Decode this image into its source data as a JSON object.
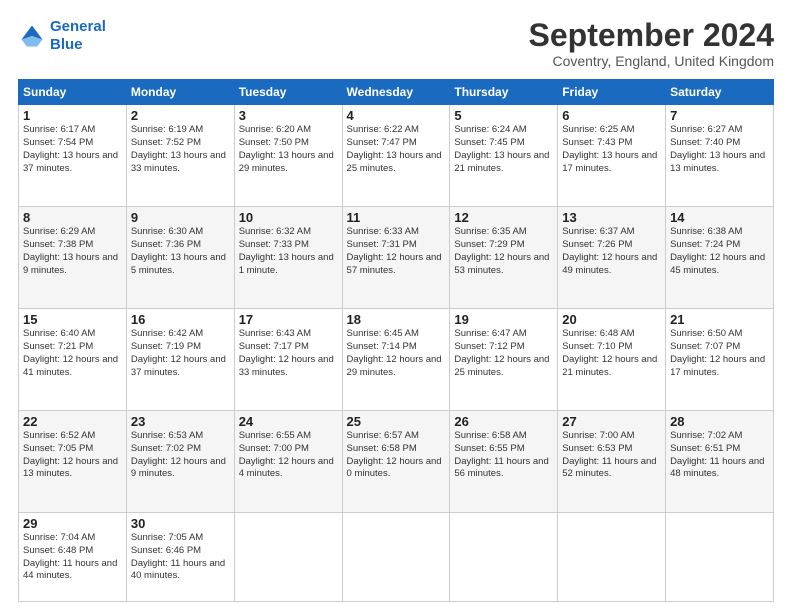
{
  "header": {
    "logo_line1": "General",
    "logo_line2": "Blue",
    "month_title": "September 2024",
    "location": "Coventry, England, United Kingdom"
  },
  "days_of_week": [
    "Sunday",
    "Monday",
    "Tuesday",
    "Wednesday",
    "Thursday",
    "Friday",
    "Saturday"
  ],
  "weeks": [
    [
      {
        "day": "1",
        "sunrise": "Sunrise: 6:17 AM",
        "sunset": "Sunset: 7:54 PM",
        "daylight": "Daylight: 13 hours and 37 minutes."
      },
      {
        "day": "2",
        "sunrise": "Sunrise: 6:19 AM",
        "sunset": "Sunset: 7:52 PM",
        "daylight": "Daylight: 13 hours and 33 minutes."
      },
      {
        "day": "3",
        "sunrise": "Sunrise: 6:20 AM",
        "sunset": "Sunset: 7:50 PM",
        "daylight": "Daylight: 13 hours and 29 minutes."
      },
      {
        "day": "4",
        "sunrise": "Sunrise: 6:22 AM",
        "sunset": "Sunset: 7:47 PM",
        "daylight": "Daylight: 13 hours and 25 minutes."
      },
      {
        "day": "5",
        "sunrise": "Sunrise: 6:24 AM",
        "sunset": "Sunset: 7:45 PM",
        "daylight": "Daylight: 13 hours and 21 minutes."
      },
      {
        "day": "6",
        "sunrise": "Sunrise: 6:25 AM",
        "sunset": "Sunset: 7:43 PM",
        "daylight": "Daylight: 13 hours and 17 minutes."
      },
      {
        "day": "7",
        "sunrise": "Sunrise: 6:27 AM",
        "sunset": "Sunset: 7:40 PM",
        "daylight": "Daylight: 13 hours and 13 minutes."
      }
    ],
    [
      {
        "day": "8",
        "sunrise": "Sunrise: 6:29 AM",
        "sunset": "Sunset: 7:38 PM",
        "daylight": "Daylight: 13 hours and 9 minutes."
      },
      {
        "day": "9",
        "sunrise": "Sunrise: 6:30 AM",
        "sunset": "Sunset: 7:36 PM",
        "daylight": "Daylight: 13 hours and 5 minutes."
      },
      {
        "day": "10",
        "sunrise": "Sunrise: 6:32 AM",
        "sunset": "Sunset: 7:33 PM",
        "daylight": "Daylight: 13 hours and 1 minute."
      },
      {
        "day": "11",
        "sunrise": "Sunrise: 6:33 AM",
        "sunset": "Sunset: 7:31 PM",
        "daylight": "Daylight: 12 hours and 57 minutes."
      },
      {
        "day": "12",
        "sunrise": "Sunrise: 6:35 AM",
        "sunset": "Sunset: 7:29 PM",
        "daylight": "Daylight: 12 hours and 53 minutes."
      },
      {
        "day": "13",
        "sunrise": "Sunrise: 6:37 AM",
        "sunset": "Sunset: 7:26 PM",
        "daylight": "Daylight: 12 hours and 49 minutes."
      },
      {
        "day": "14",
        "sunrise": "Sunrise: 6:38 AM",
        "sunset": "Sunset: 7:24 PM",
        "daylight": "Daylight: 12 hours and 45 minutes."
      }
    ],
    [
      {
        "day": "15",
        "sunrise": "Sunrise: 6:40 AM",
        "sunset": "Sunset: 7:21 PM",
        "daylight": "Daylight: 12 hours and 41 minutes."
      },
      {
        "day": "16",
        "sunrise": "Sunrise: 6:42 AM",
        "sunset": "Sunset: 7:19 PM",
        "daylight": "Daylight: 12 hours and 37 minutes."
      },
      {
        "day": "17",
        "sunrise": "Sunrise: 6:43 AM",
        "sunset": "Sunset: 7:17 PM",
        "daylight": "Daylight: 12 hours and 33 minutes."
      },
      {
        "day": "18",
        "sunrise": "Sunrise: 6:45 AM",
        "sunset": "Sunset: 7:14 PM",
        "daylight": "Daylight: 12 hours and 29 minutes."
      },
      {
        "day": "19",
        "sunrise": "Sunrise: 6:47 AM",
        "sunset": "Sunset: 7:12 PM",
        "daylight": "Daylight: 12 hours and 25 minutes."
      },
      {
        "day": "20",
        "sunrise": "Sunrise: 6:48 AM",
        "sunset": "Sunset: 7:10 PM",
        "daylight": "Daylight: 12 hours and 21 minutes."
      },
      {
        "day": "21",
        "sunrise": "Sunrise: 6:50 AM",
        "sunset": "Sunset: 7:07 PM",
        "daylight": "Daylight: 12 hours and 17 minutes."
      }
    ],
    [
      {
        "day": "22",
        "sunrise": "Sunrise: 6:52 AM",
        "sunset": "Sunset: 7:05 PM",
        "daylight": "Daylight: 12 hours and 13 minutes."
      },
      {
        "day": "23",
        "sunrise": "Sunrise: 6:53 AM",
        "sunset": "Sunset: 7:02 PM",
        "daylight": "Daylight: 12 hours and 9 minutes."
      },
      {
        "day": "24",
        "sunrise": "Sunrise: 6:55 AM",
        "sunset": "Sunset: 7:00 PM",
        "daylight": "Daylight: 12 hours and 4 minutes."
      },
      {
        "day": "25",
        "sunrise": "Sunrise: 6:57 AM",
        "sunset": "Sunset: 6:58 PM",
        "daylight": "Daylight: 12 hours and 0 minutes."
      },
      {
        "day": "26",
        "sunrise": "Sunrise: 6:58 AM",
        "sunset": "Sunset: 6:55 PM",
        "daylight": "Daylight: 11 hours and 56 minutes."
      },
      {
        "day": "27",
        "sunrise": "Sunrise: 7:00 AM",
        "sunset": "Sunset: 6:53 PM",
        "daylight": "Daylight: 11 hours and 52 minutes."
      },
      {
        "day": "28",
        "sunrise": "Sunrise: 7:02 AM",
        "sunset": "Sunset: 6:51 PM",
        "daylight": "Daylight: 11 hours and 48 minutes."
      }
    ],
    [
      {
        "day": "29",
        "sunrise": "Sunrise: 7:04 AM",
        "sunset": "Sunset: 6:48 PM",
        "daylight": "Daylight: 11 hours and 44 minutes."
      },
      {
        "day": "30",
        "sunrise": "Sunrise: 7:05 AM",
        "sunset": "Sunset: 6:46 PM",
        "daylight": "Daylight: 11 hours and 40 minutes."
      },
      null,
      null,
      null,
      null,
      null
    ]
  ]
}
